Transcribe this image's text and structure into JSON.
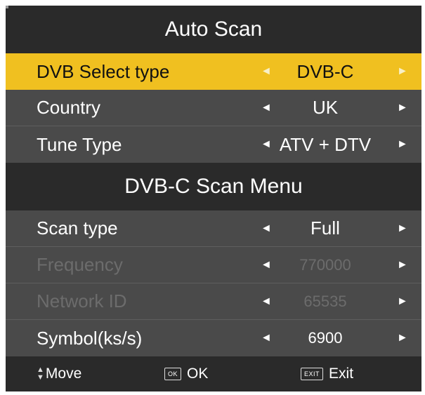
{
  "header": {
    "title": "Auto Scan"
  },
  "auto_scan_rows": [
    {
      "label": "DVB Select type",
      "value": "DVB-C"
    },
    {
      "label": "Country",
      "value": "UK"
    },
    {
      "label": "Tune Type",
      "value": "ATV + DTV"
    }
  ],
  "section": {
    "title": "DVB-C Scan Menu"
  },
  "scan_rows": [
    {
      "label": "Scan type",
      "value": "Full"
    },
    {
      "label": "Frequency",
      "value": "770000"
    },
    {
      "label": "Network ID",
      "value": "65535"
    },
    {
      "label": "Symbol(ks/s)",
      "value": "6900"
    }
  ],
  "arrows": {
    "left": "◄",
    "right": "►"
  },
  "footer": {
    "move_label": "Move",
    "ok_key": "OK",
    "ok_label": "OK",
    "exit_key": "EXIT",
    "exit_label": "Exit",
    "up_glyph": "▲",
    "down_glyph": "▼"
  },
  "colors": {
    "highlight": "#f0c020",
    "panel": "#4a4a4a",
    "title_bar": "#2a2a2a",
    "disabled_text": "#6c6c6c"
  }
}
